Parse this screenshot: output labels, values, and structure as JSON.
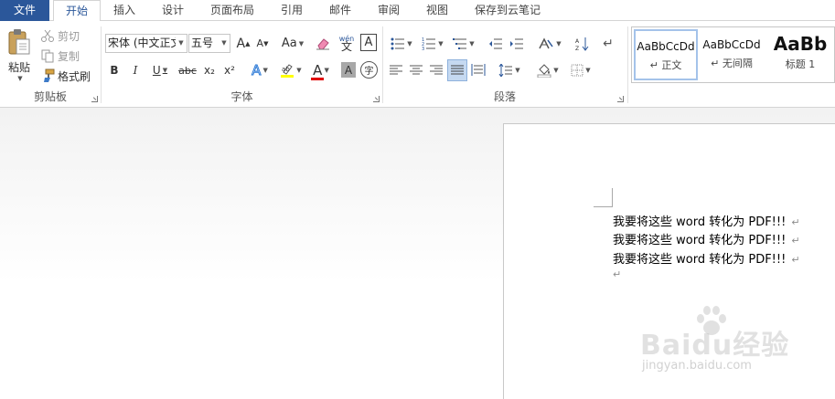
{
  "tabs": [
    {
      "label": "文件"
    },
    {
      "label": "开始"
    },
    {
      "label": "插入"
    },
    {
      "label": "设计"
    },
    {
      "label": "页面布局"
    },
    {
      "label": "引用"
    },
    {
      "label": "邮件"
    },
    {
      "label": "审阅"
    },
    {
      "label": "视图"
    },
    {
      "label": "保存到云笔记"
    }
  ],
  "clipboard": {
    "paste_label": "粘贴",
    "cut_label": "剪切",
    "copy_label": "复制",
    "format_painter_label": "格式刷",
    "group_label": "剪贴板"
  },
  "font": {
    "font_name": "宋体 (中文正文",
    "font_size": "五号",
    "grow_label": "A",
    "shrink_label": "A",
    "case_label": "Aa",
    "phonetic_label": "wén",
    "border_char_label": "A",
    "bold_label": "B",
    "italic_label": "I",
    "underline_label": "U",
    "strike_label": "abc",
    "subscript_label": "x₂",
    "superscript_label": "x²",
    "effects_label": "A",
    "color_label": "A",
    "shading_label": "A",
    "enclose_label": "字",
    "group_label": "字体",
    "highlight_color": "#ffff00",
    "font_color": "#e00000"
  },
  "paragraph": {
    "group_label": "段落"
  },
  "styles": {
    "items": [
      {
        "sample": "AaBbCcDd",
        "name": "↵ 正文"
      },
      {
        "sample": "AaBbCcDd",
        "name": "↵ 无间隔"
      },
      {
        "sample": "AaBb",
        "name": "标题 1"
      }
    ]
  },
  "document": {
    "lines": [
      {
        "text": "我要将这些 word 转化为 PDF!!!"
      },
      {
        "text": "我要将这些 word 转化为 PDF!!!"
      },
      {
        "text": "我要将这些 word 转化为 PDF!!!"
      }
    ],
    "line_mark": "↵",
    "empty_para_mark": "↵"
  },
  "watermark": {
    "logo": "Baidu经验",
    "url": "jingyan.baidu.com"
  },
  "colors": {
    "accent": "#2b579a"
  }
}
